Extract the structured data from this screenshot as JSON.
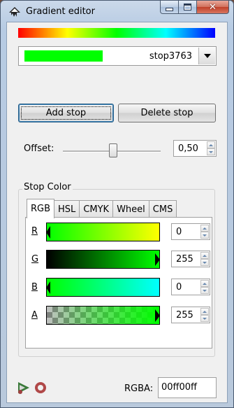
{
  "window": {
    "title": "Gradient editor",
    "icon": "inkscape-icon",
    "controls": [
      "minimize-icon",
      "maximize-icon",
      "close-icon"
    ]
  },
  "gradient": {
    "colors": [
      "#ff0000",
      "#ffff00",
      "#00ff00",
      "#00ffff",
      "#0000ff"
    ]
  },
  "stop_selector": {
    "swatch_color": "#00ff00",
    "selected": "stop3763"
  },
  "buttons": {
    "add_stop": "Add stop",
    "delete_stop": "Delete stop"
  },
  "offset": {
    "label": "Offset:",
    "value": "0,50",
    "fraction": 0.5
  },
  "stop_color": {
    "frame_label": "Stop Color",
    "tabs": [
      "RGB",
      "HSL",
      "CMYK",
      "Wheel",
      "CMS"
    ],
    "active_tab": "RGB",
    "channels": [
      {
        "label": "R",
        "value": "0"
      },
      {
        "label": "G",
        "value": "255"
      },
      {
        "label": "B",
        "value": "0"
      },
      {
        "label": "A",
        "value": "255"
      }
    ]
  },
  "footer": {
    "icons": [
      "color-picker-icon",
      "color-managed-icon"
    ],
    "rgba_label": "RGBA:",
    "rgba_value": "00ff00ff"
  }
}
